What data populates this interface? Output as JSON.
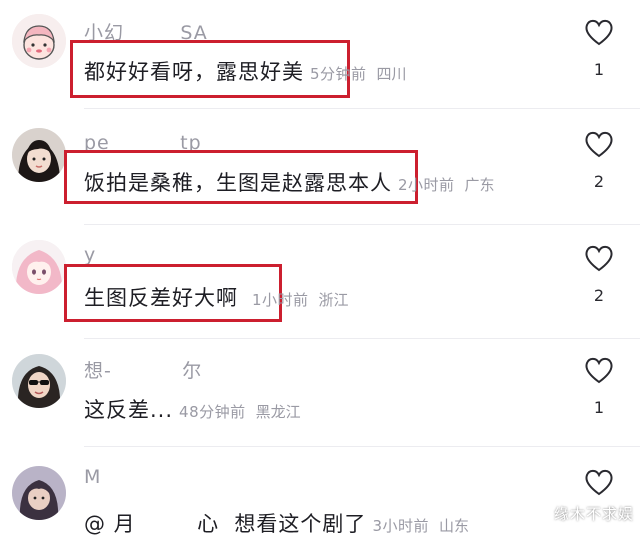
{
  "comments": [
    {
      "username": "小幻        SA",
      "text": "都好好看呀，露思好美",
      "time": "5分钟前",
      "location": "四川",
      "likes": "1",
      "avatar_icon": "cartoon-girl-avatar"
    },
    {
      "username": "pe          tp",
      "text": "饭拍是桑稚，生图是赵露思本人",
      "time": "2小时前",
      "location": "广东",
      "likes": "2",
      "avatar_icon": "photo-girl-avatar"
    },
    {
      "username": "y",
      "text": "生图反差好大啊",
      "time": "1小时前",
      "location": "浙江",
      "likes": "2",
      "avatar_icon": "pink-hair-anime-avatar"
    },
    {
      "username": "想-          尔",
      "text": "这反差...",
      "time": "48分钟前",
      "location": "黑龙江",
      "likes": "1",
      "avatar_icon": "photo-woman-sunglasses-avatar"
    },
    {
      "username": "M",
      "text": "@ 月        心  想看这个剧了",
      "time": "3小时前",
      "location": "山东",
      "likes": "",
      "avatar_icon": "photo-person-avatar"
    }
  ],
  "watermark": "缘木不求娱",
  "colors": {
    "highlight_box": "#cc1f2f",
    "meta_text": "#9a9aa4",
    "comment_text": "#1e1e24"
  }
}
